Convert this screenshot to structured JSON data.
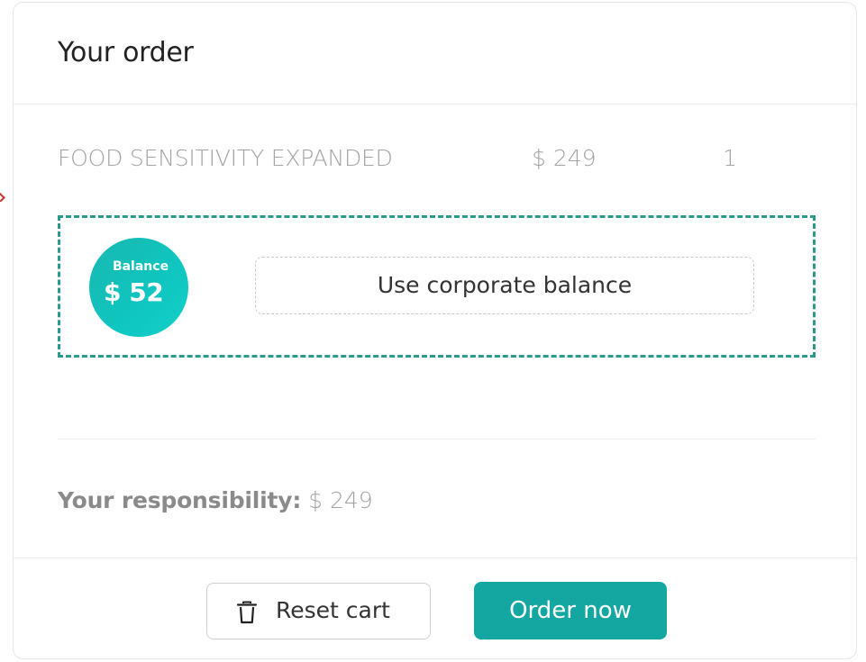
{
  "order": {
    "title": "Your order",
    "item": {
      "name": "FOOD SENSITIVITY EXPANDED",
      "price": "$ 249",
      "quantity": "1"
    },
    "balance": {
      "label": "Balance",
      "amount": "$ 52",
      "button_label": "Use corporate balance"
    },
    "responsibility": {
      "label": "Your responsibility:",
      "value": "$ 249"
    },
    "actions": {
      "reset_label": "Reset cart",
      "order_label": "Order now"
    }
  },
  "colors": {
    "accent": "#14a6a0",
    "dashed_border": "#2a9a8c",
    "badge": "#0fc6c0"
  },
  "icons": {
    "reset": "trash-icon"
  }
}
